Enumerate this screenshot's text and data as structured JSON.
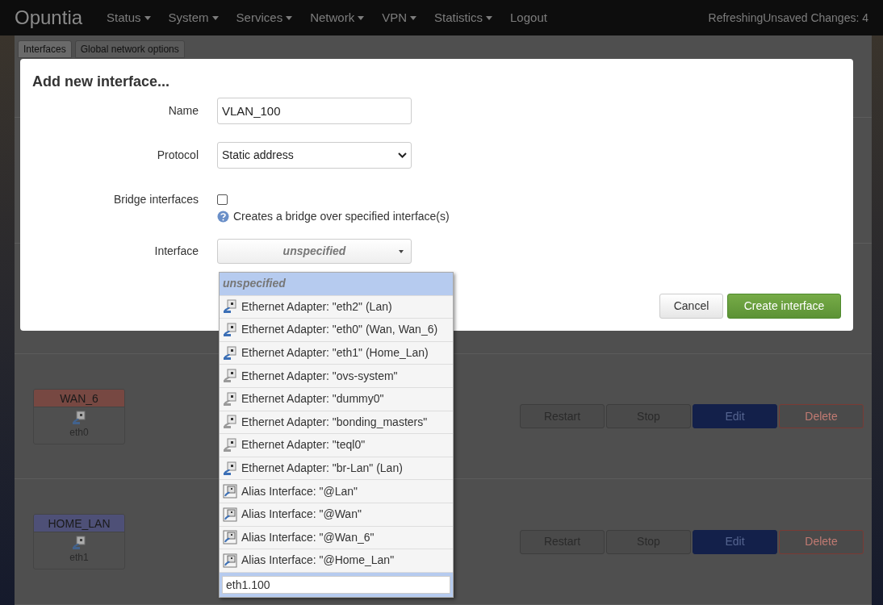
{
  "nav": {
    "brand": "Opuntia",
    "menus": [
      {
        "label": "Status",
        "dropdown": true
      },
      {
        "label": "System",
        "dropdown": true
      },
      {
        "label": "Services",
        "dropdown": true
      },
      {
        "label": "Network",
        "dropdown": true
      },
      {
        "label": "VPN",
        "dropdown": true
      },
      {
        "label": "Statistics",
        "dropdown": true
      },
      {
        "label": "Logout",
        "dropdown": false
      }
    ],
    "status": "RefreshingUnsaved Changes: 4"
  },
  "tabs": [
    {
      "label": "Interfaces",
      "selected": true
    },
    {
      "label": "Global network options",
      "selected": false
    }
  ],
  "interfaces": [
    {
      "name": "WAN_6",
      "color": "#774842",
      "device": "eth0",
      "buttons": [
        {
          "label": "Restart",
          "kind": "default"
        },
        {
          "label": "Stop",
          "kind": "default"
        },
        {
          "label": "Edit",
          "kind": "primary"
        },
        {
          "label": "Delete",
          "kind": "danger"
        }
      ]
    },
    {
      "name": "HOME_LAN",
      "color": "#4e5077",
      "device": "eth1",
      "buttons": [
        {
          "label": "Restart",
          "kind": "default"
        },
        {
          "label": "Stop",
          "kind": "default"
        },
        {
          "label": "Edit",
          "kind": "primary"
        },
        {
          "label": "Delete",
          "kind": "danger"
        }
      ]
    }
  ],
  "dialog": {
    "title": "Add new interface...",
    "name": {
      "label": "Name",
      "value": "VLAN_100"
    },
    "protocol": {
      "label": "Protocol",
      "value": "Static address"
    },
    "bridge": {
      "label": "Bridge interfaces",
      "checked": false,
      "hint": "Creates a bridge over specified interface(s)"
    },
    "interface": {
      "label": "Interface",
      "value": "unspecified",
      "open": true,
      "search_value": "eth1.100",
      "options": [
        {
          "label": "unspecified",
          "kind": "none",
          "selected": true
        },
        {
          "label": "Ethernet Adapter: \"eth2\" (Lan)",
          "kind": "ethernet",
          "selected": false,
          "in_use": true
        },
        {
          "label": "Ethernet Adapter: \"eth0\" (Wan, Wan_6)",
          "kind": "ethernet",
          "selected": false,
          "in_use": true
        },
        {
          "label": "Ethernet Adapter: \"eth1\" (Home_Lan)",
          "kind": "ethernet",
          "selected": false,
          "in_use": true
        },
        {
          "label": "Ethernet Adapter: \"ovs-system\"",
          "kind": "ethernet",
          "selected": false,
          "in_use": false
        },
        {
          "label": "Ethernet Adapter: \"dummy0\"",
          "kind": "ethernet",
          "selected": false,
          "in_use": false
        },
        {
          "label": "Ethernet Adapter: \"bonding_masters\"",
          "kind": "ethernet",
          "selected": false,
          "in_use": false
        },
        {
          "label": "Ethernet Adapter: \"teql0\"",
          "kind": "ethernet",
          "selected": false,
          "in_use": false
        },
        {
          "label": "Ethernet Adapter: \"br-Lan\" (Lan)",
          "kind": "ethernet",
          "selected": false,
          "in_use": true
        },
        {
          "label": "Alias Interface: \"@Lan\"",
          "kind": "alias",
          "selected": false,
          "in_use": true
        },
        {
          "label": "Alias Interface: \"@Wan\"",
          "kind": "alias",
          "selected": false,
          "in_use": true
        },
        {
          "label": "Alias Interface: \"@Wan_6\"",
          "kind": "alias",
          "selected": false,
          "in_use": true
        },
        {
          "label": "Alias Interface: \"@Home_Lan\"",
          "kind": "alias",
          "selected": false,
          "in_use": true
        }
      ]
    },
    "cancel": "Cancel",
    "create": "Create interface"
  }
}
